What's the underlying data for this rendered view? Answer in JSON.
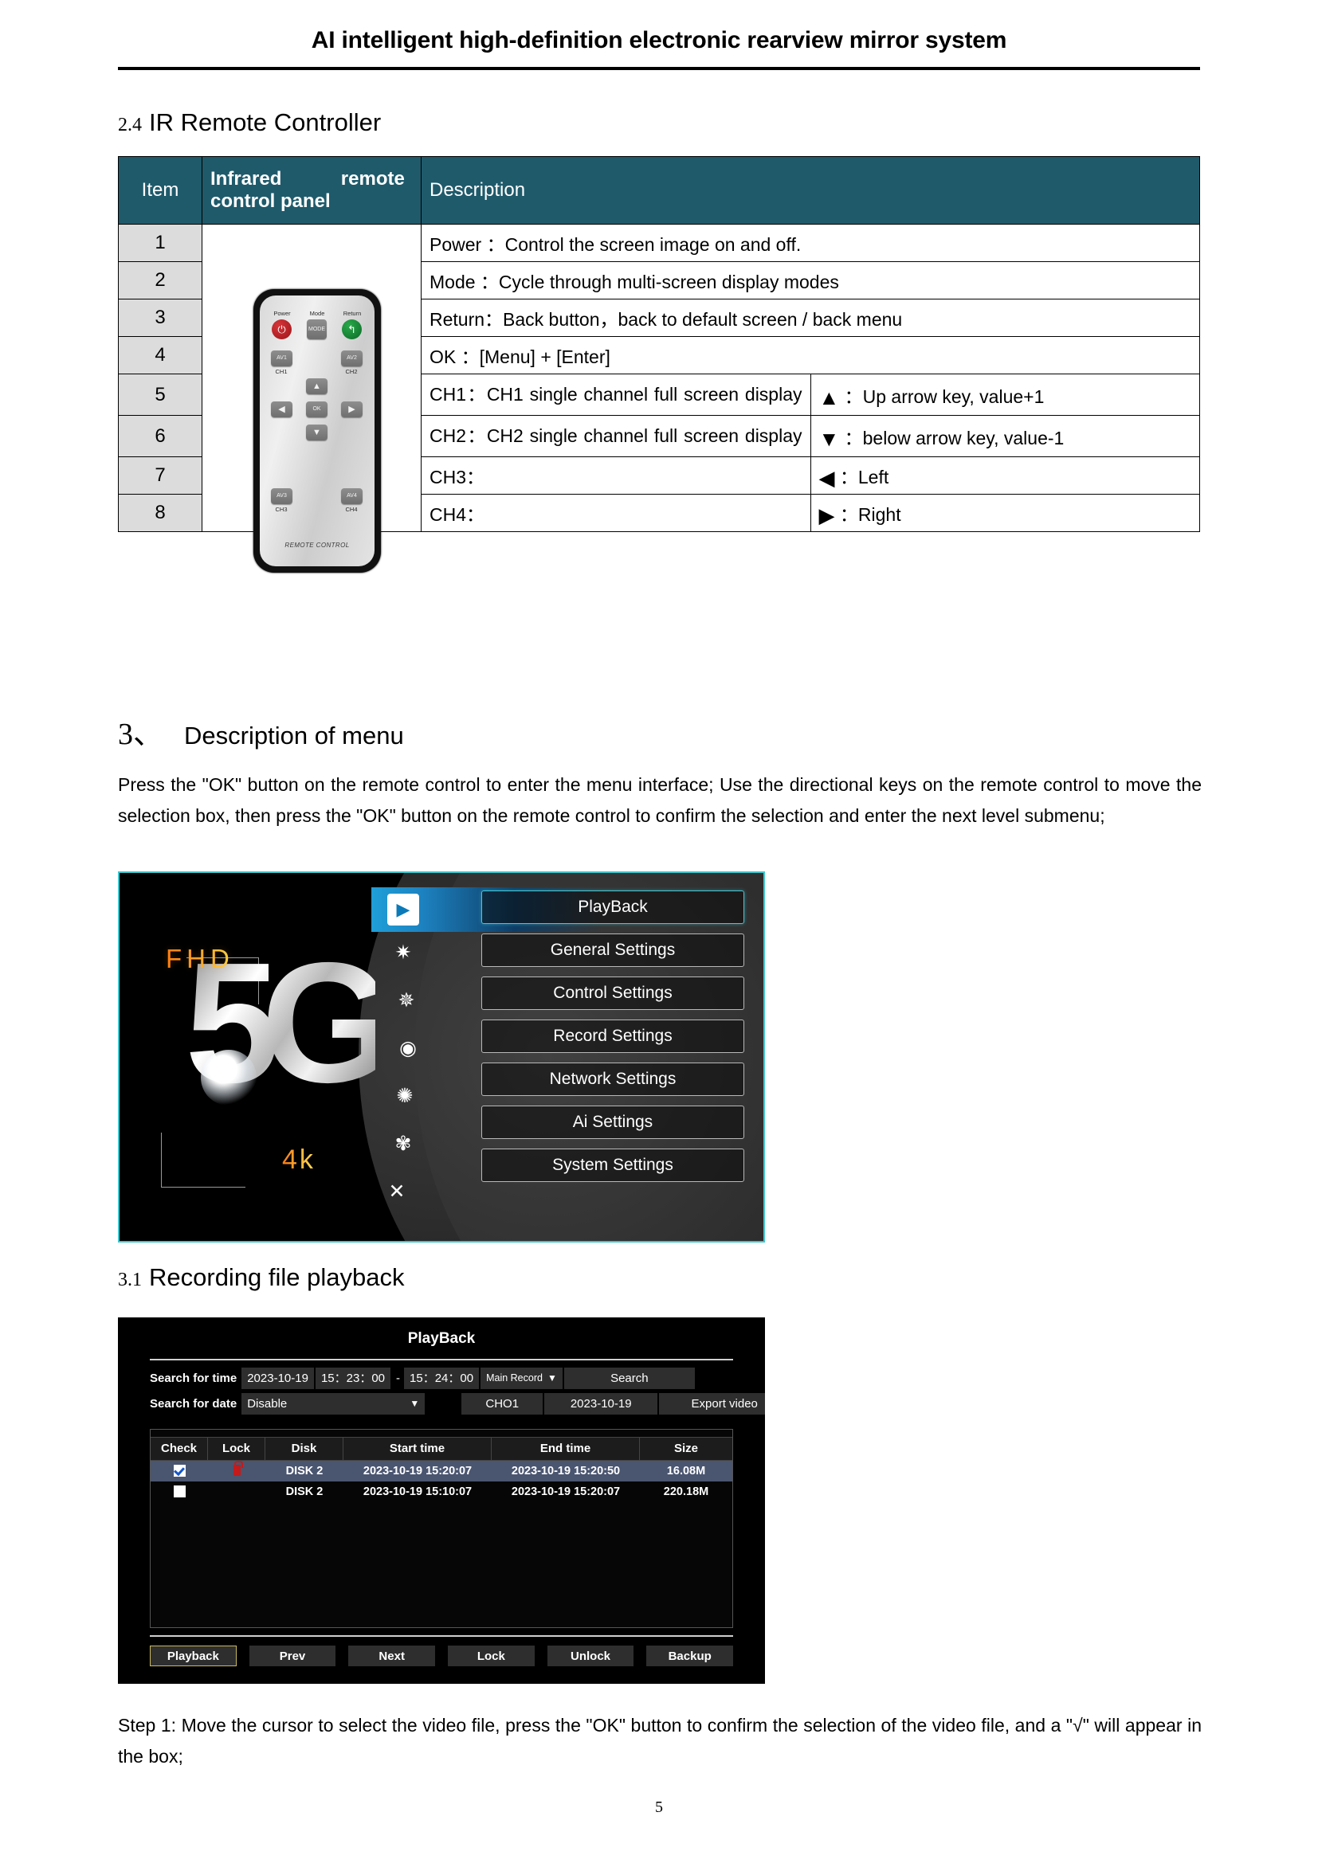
{
  "document": {
    "running_head": "AI intelligent high-definition electronic rearview mirror system",
    "page_number": "5"
  },
  "section_24": {
    "number": "2.4",
    "title": "IR Remote Controller",
    "table": {
      "headers": {
        "item": "Item",
        "panel_line1": "Infrared",
        "panel_line2": "remote",
        "panel_line3": "control panel",
        "description": "Description"
      },
      "rows": [
        {
          "item": "1",
          "description": "Power ：Control the screen image on and off."
        },
        {
          "item": "2",
          "description": "Mode  ：Cycle through multi-screen display modes"
        },
        {
          "item": "3",
          "description": "Return：Back button，back to default screen / back menu"
        },
        {
          "item": "4",
          "description": "OK ：[Menu] + [Enter]"
        },
        {
          "item": "5",
          "description": "CH1：CH1 single channel full screen display",
          "arrow_glyph": "▲",
          "arrow_text": "：Up arrow key, value+1",
          "arrow_icon": "up-arrow-icon"
        },
        {
          "item": "6",
          "description": "CH2：CH2 single channel full screen display",
          "arrow_glyph": "▼",
          "arrow_text": "：below arrow key, value-1",
          "arrow_icon": "down-arrow-icon"
        },
        {
          "item": "7",
          "description": "CH3：",
          "arrow_glyph": "◀",
          "arrow_text": "：Left",
          "arrow_icon": "left-arrow-icon"
        },
        {
          "item": "8",
          "description": "CH4：",
          "arrow_glyph": "▶",
          "arrow_text": "：Right",
          "arrow_icon": "right-arrow-icon"
        }
      ],
      "header_bg": "#1f5a6b",
      "item_cell_bg": "#dcdcdc"
    }
  },
  "remote_image": {
    "labels": {
      "power": "Power",
      "mode": "Mode",
      "return": "Return"
    },
    "buttons": {
      "mode": "MODE",
      "av1": "AV1",
      "av2": "AV2",
      "av3": "AV3",
      "av4": "AV4",
      "ok": "OK",
      "up": "▲",
      "down": "▼",
      "left": "◀",
      "right": "▶",
      "power_glyph": "⏻",
      "return_glyph": "↰"
    },
    "channel_labels": {
      "ch1": "CH1",
      "ch2": "CH2",
      "ch3": "CH3",
      "ch4": "CH4"
    },
    "footer": "REMOTE CONTROL"
  },
  "section_3": {
    "number": "3、",
    "title": "Description of menu",
    "paragraph": "Press the \"OK\" button on the remote control to enter the menu interface; Use the directional keys on the remote control to move the selection box, then press the \"OK\" button on the remote control to confirm the selection and enter the next level submenu;"
  },
  "main_menu_screenshot": {
    "hero": {
      "fhd": "FHD",
      "fourk": "4k",
      "logo": "5G"
    },
    "border_color": "#3fc7cf",
    "icons": [
      {
        "name": "play-icon",
        "glyph": "▶"
      },
      {
        "name": "gear-icon",
        "glyph": "✷"
      },
      {
        "name": "double-gear-icon",
        "glyph": "✵"
      },
      {
        "name": "camera-lens-icon",
        "glyph": "◉"
      },
      {
        "name": "globe-network-icon",
        "glyph": "✺"
      },
      {
        "name": "ai-gear-icon",
        "glyph": "✾"
      },
      {
        "name": "tools-icon",
        "glyph": "✕"
      }
    ],
    "items": [
      {
        "label": "PlayBack",
        "selected": true
      },
      {
        "label": "General Settings",
        "selected": false
      },
      {
        "label": "Control Settings",
        "selected": false
      },
      {
        "label": "Record Settings",
        "selected": false
      },
      {
        "label": "Network Settings",
        "selected": false
      },
      {
        "label": "Ai Settings",
        "selected": false
      },
      {
        "label": "System Settings",
        "selected": false
      }
    ]
  },
  "section_31": {
    "number": "3.1",
    "title": "Recording file playback",
    "step_paragraph": "Step 1: Move the cursor to select the video file, press the \"OK\" button to confirm the selection of the video file, and a \"√\" will appear in the box;"
  },
  "playback_screenshot": {
    "title": "PlayBack",
    "search_time": {
      "label": "Search for time",
      "date_value": "2023-10-19",
      "start_time": "15：23：00",
      "separator": "-",
      "end_time": "15：24：00",
      "record_type": "Main Record",
      "search_button": "Search"
    },
    "search_date": {
      "label": "Search for date",
      "value": "Disable",
      "channel": "CHO1",
      "date": "2023-10-19",
      "export_button": "Export video"
    },
    "table": {
      "columns": [
        "Check",
        "Lock",
        "Disk",
        "Start time",
        "End time",
        "Size"
      ],
      "rows": [
        {
          "checked": true,
          "locked": true,
          "disk": "DISK 2",
          "start_time": "2023-10-19  15:20:07",
          "end_time": "2023-10-19  15:20:50",
          "size": "16.08M",
          "selected": true
        },
        {
          "checked": false,
          "locked": false,
          "disk": "DISK 2",
          "start_time": "2023-10-19  15:10:07",
          "end_time": "2023-10-19  15:20:07",
          "size": "220.18M",
          "selected": false
        }
      ]
    },
    "buttons": [
      {
        "label": "Playback",
        "focused": true
      },
      {
        "label": "Prev",
        "focused": false
      },
      {
        "label": "Next",
        "focused": false
      },
      {
        "label": "Lock",
        "focused": false
      },
      {
        "label": "Unlock",
        "focused": false
      },
      {
        "label": "Backup",
        "focused": false
      }
    ]
  }
}
